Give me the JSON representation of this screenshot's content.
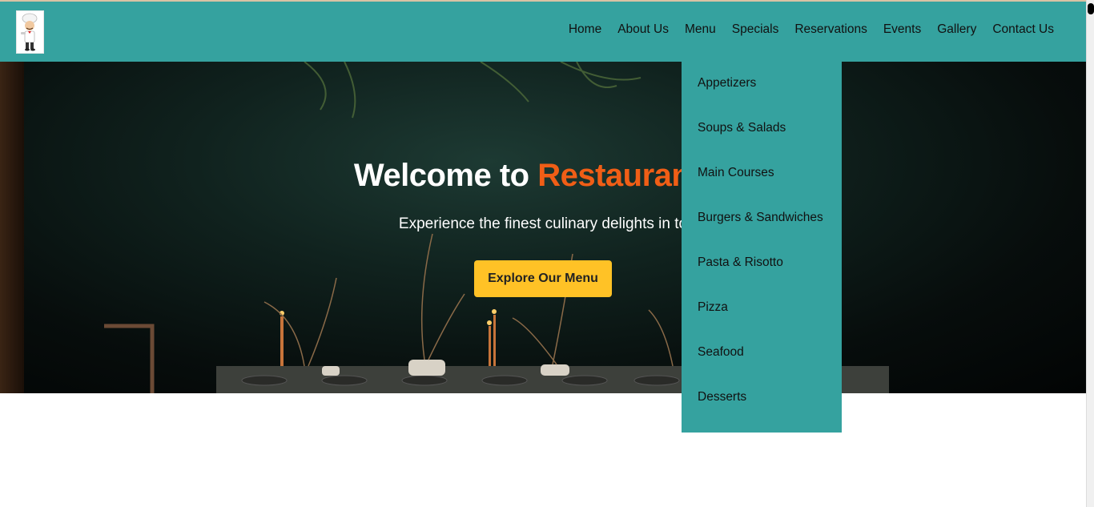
{
  "brand": {
    "logo_icon": "chef-logo-icon"
  },
  "nav": {
    "items": [
      {
        "label": "Home"
      },
      {
        "label": "About Us"
      },
      {
        "label": "Menu"
      },
      {
        "label": "Specials"
      },
      {
        "label": "Reservations"
      },
      {
        "label": "Events"
      },
      {
        "label": "Gallery"
      },
      {
        "label": "Contact Us"
      }
    ]
  },
  "hero": {
    "title_prefix": "Welcome to ",
    "title_accent": "Restaurant N",
    "subtitle": "Experience the finest culinary delights in to",
    "cta_label": "Explore Our Menu"
  },
  "menu_dropdown": {
    "items": [
      {
        "label": "Appetizers"
      },
      {
        "label": "Soups & Salads"
      },
      {
        "label": "Main Courses"
      },
      {
        "label": "Burgers & Sandwiches"
      },
      {
        "label": "Pasta & Risotto"
      },
      {
        "label": "Pizza"
      },
      {
        "label": "Seafood"
      },
      {
        "label": "Desserts"
      }
    ]
  },
  "colors": {
    "navbar_bg": "#35a29f",
    "accent_orange": "#f05e16",
    "cta_yellow": "#ffc226"
  }
}
